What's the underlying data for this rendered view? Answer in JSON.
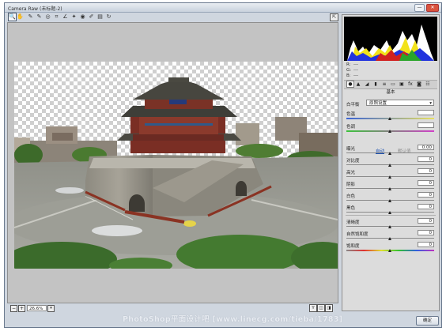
{
  "window": {
    "title": "Camera Raw (未标题-2)",
    "close": "✕",
    "minimize": "—"
  },
  "toolbar": {
    "tools": [
      {
        "icon": "zoom-icon",
        "glyph": "🔍"
      },
      {
        "icon": "hand-icon",
        "glyph": "✋"
      },
      {
        "icon": "white-balance-icon",
        "glyph": "✎"
      },
      {
        "icon": "color-sampler-icon",
        "glyph": "✎"
      },
      {
        "icon": "target-adjust-icon",
        "glyph": "◎"
      },
      {
        "icon": "crop-icon",
        "glyph": "⌗"
      },
      {
        "icon": "straighten-icon",
        "glyph": "∠"
      },
      {
        "icon": "spot-removal-icon",
        "glyph": "✦"
      },
      {
        "icon": "red-eye-icon",
        "glyph": "◉"
      },
      {
        "icon": "adjustment-brush-icon",
        "glyph": "✐"
      },
      {
        "icon": "graduated-filter-icon",
        "glyph": "▤"
      },
      {
        "icon": "rotate-icon",
        "glyph": "↻"
      }
    ],
    "fullscreen_glyph": "⇱"
  },
  "histogram": {
    "readout": [
      {
        "key": "R:",
        "value": "---"
      },
      {
        "key": "G:",
        "value": "---"
      },
      {
        "key": "B:",
        "value": "---"
      }
    ]
  },
  "panel": {
    "tab_glyphs": [
      "●",
      "▲",
      "◢",
      "▮",
      "≡",
      "▭",
      "▣",
      "fx",
      "◙",
      "☷"
    ],
    "section_title": "基本",
    "white_balance_label": "白平衡",
    "white_balance_value": "原照设置",
    "auto_label": "自动",
    "default_label": "默认值",
    "sliders": [
      {
        "label": "色温",
        "value": "",
        "fraction": 0.5
      },
      {
        "label": "色调",
        "value": "",
        "fraction": 0.5
      },
      {
        "label": "曝光",
        "value": "0.00",
        "fraction": 0.5
      },
      {
        "label": "对比度",
        "value": "0",
        "fraction": 0.5
      },
      {
        "label": "高光",
        "value": "0",
        "fraction": 0.5
      },
      {
        "label": "阴影",
        "value": "0",
        "fraction": 0.5
      },
      {
        "label": "白色",
        "value": "0",
        "fraction": 0.5
      },
      {
        "label": "黑色",
        "value": "0",
        "fraction": 0.5
      },
      {
        "label": "清晰度",
        "value": "0",
        "fraction": 0.5
      },
      {
        "label": "自然饱和度",
        "value": "0",
        "fraction": 0.5
      },
      {
        "label": "饱和度",
        "value": "0",
        "fraction": 0.5
      }
    ]
  },
  "bottom": {
    "zoom_minus": "−",
    "zoom_plus": "+",
    "zoom_value": "26.6%",
    "zoom_drop": "▾",
    "view_buttons": [
      "Y",
      "◫",
      "◨"
    ],
    "status": "PhotoShop平面设计吧 [www.linecg.com/tieba/1783]",
    "done_label": "确定"
  },
  "colors": {
    "accent": "#1a4fb0",
    "panel": "#dcdcdc",
    "preview_bg": "#c3c3c3"
  }
}
